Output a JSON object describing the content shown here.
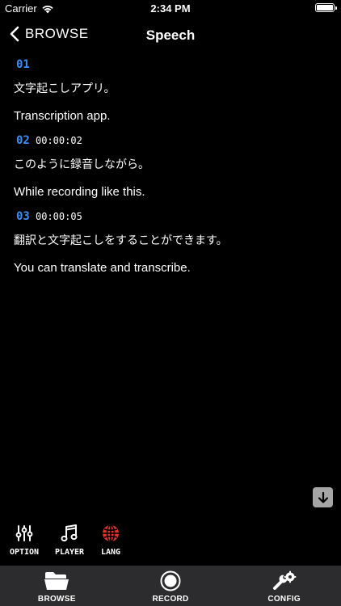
{
  "status_bar": {
    "carrier": "Carrier",
    "time": "2:34 PM"
  },
  "nav": {
    "back_label": "BROWSE",
    "title": "Speech"
  },
  "transcript": [
    {
      "num": "01",
      "time": "",
      "original": "文字起こしアプリ。",
      "translation": "Transcription app."
    },
    {
      "num": "02",
      "time": "00:00:02",
      "original": "このように録音しながら。",
      "translation": "While recording like this."
    },
    {
      "num": "03",
      "time": "00:00:05",
      "original": "翻訳と文字起こしをすることができます。",
      "translation": "You can translate and transcribe."
    }
  ],
  "tools": {
    "option": {
      "label": "OPTION",
      "icon": "sliders-icon"
    },
    "player": {
      "label": "PLAYER",
      "icon": "music-note-icon"
    },
    "lang": {
      "label": "LANG",
      "icon": "globe-icon",
      "color": "#e8302a"
    }
  },
  "scroll_button": {
    "icon": "arrow-down-icon"
  },
  "tab_bar": {
    "tabs": [
      {
        "label": "BROWSE",
        "icon": "folder-icon"
      },
      {
        "label": "RECORD",
        "icon": "record-icon"
      },
      {
        "label": "CONFIG",
        "icon": "wrench-gear-icon"
      }
    ]
  },
  "colors": {
    "accent": "#3a8ef6",
    "background": "#000000",
    "tab_bar": "#2c2c2e",
    "lang_icon": "#e8302a"
  }
}
